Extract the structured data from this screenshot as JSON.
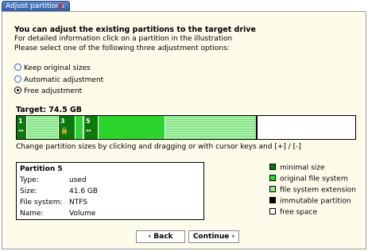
{
  "tab": {
    "title": "Adjust partitions"
  },
  "intro": {
    "heading": "You can adjust the existing partitions to the target drive",
    "line1": "For detailed information click on a partition in the illustration",
    "line2": "Please select one of the following three adjustment options:"
  },
  "options": [
    {
      "label": "Keep original sizes",
      "selected": false
    },
    {
      "label": "Automatic adjustment",
      "selected": false
    },
    {
      "label": "Free adjustment",
      "selected": true
    }
  ],
  "target": {
    "label": "Target: 74.5 GB"
  },
  "partitions": [
    {
      "number": "1",
      "icon": "resize-icon"
    },
    {
      "number": "3",
      "icon": "lock-icon"
    },
    {
      "number": "5",
      "icon": "resize-icon"
    }
  ],
  "hint": "Change partition sizes by clicking and dragging or with cursor keys and [+] / [-]",
  "info": {
    "title": "Partition 5",
    "rows": [
      {
        "key": "Type:",
        "value": "used"
      },
      {
        "key": "Size:",
        "value": "41.6 GB"
      },
      {
        "key": "File system:",
        "value": "NTFS"
      },
      {
        "key": "Name:",
        "value": "Volume"
      }
    ]
  },
  "legend": [
    {
      "label": "minimal size",
      "color": "#0b7a0b"
    },
    {
      "label": "original file system",
      "color": "#2cd52c"
    },
    {
      "label": "file system extension",
      "color": "#8fe88f"
    },
    {
      "label": "immutable partition",
      "color": "#000000"
    },
    {
      "label": "free space",
      "color": "#ffffff"
    }
  ],
  "buttons": {
    "back": "‹ Back",
    "continue": "Continue ›"
  }
}
